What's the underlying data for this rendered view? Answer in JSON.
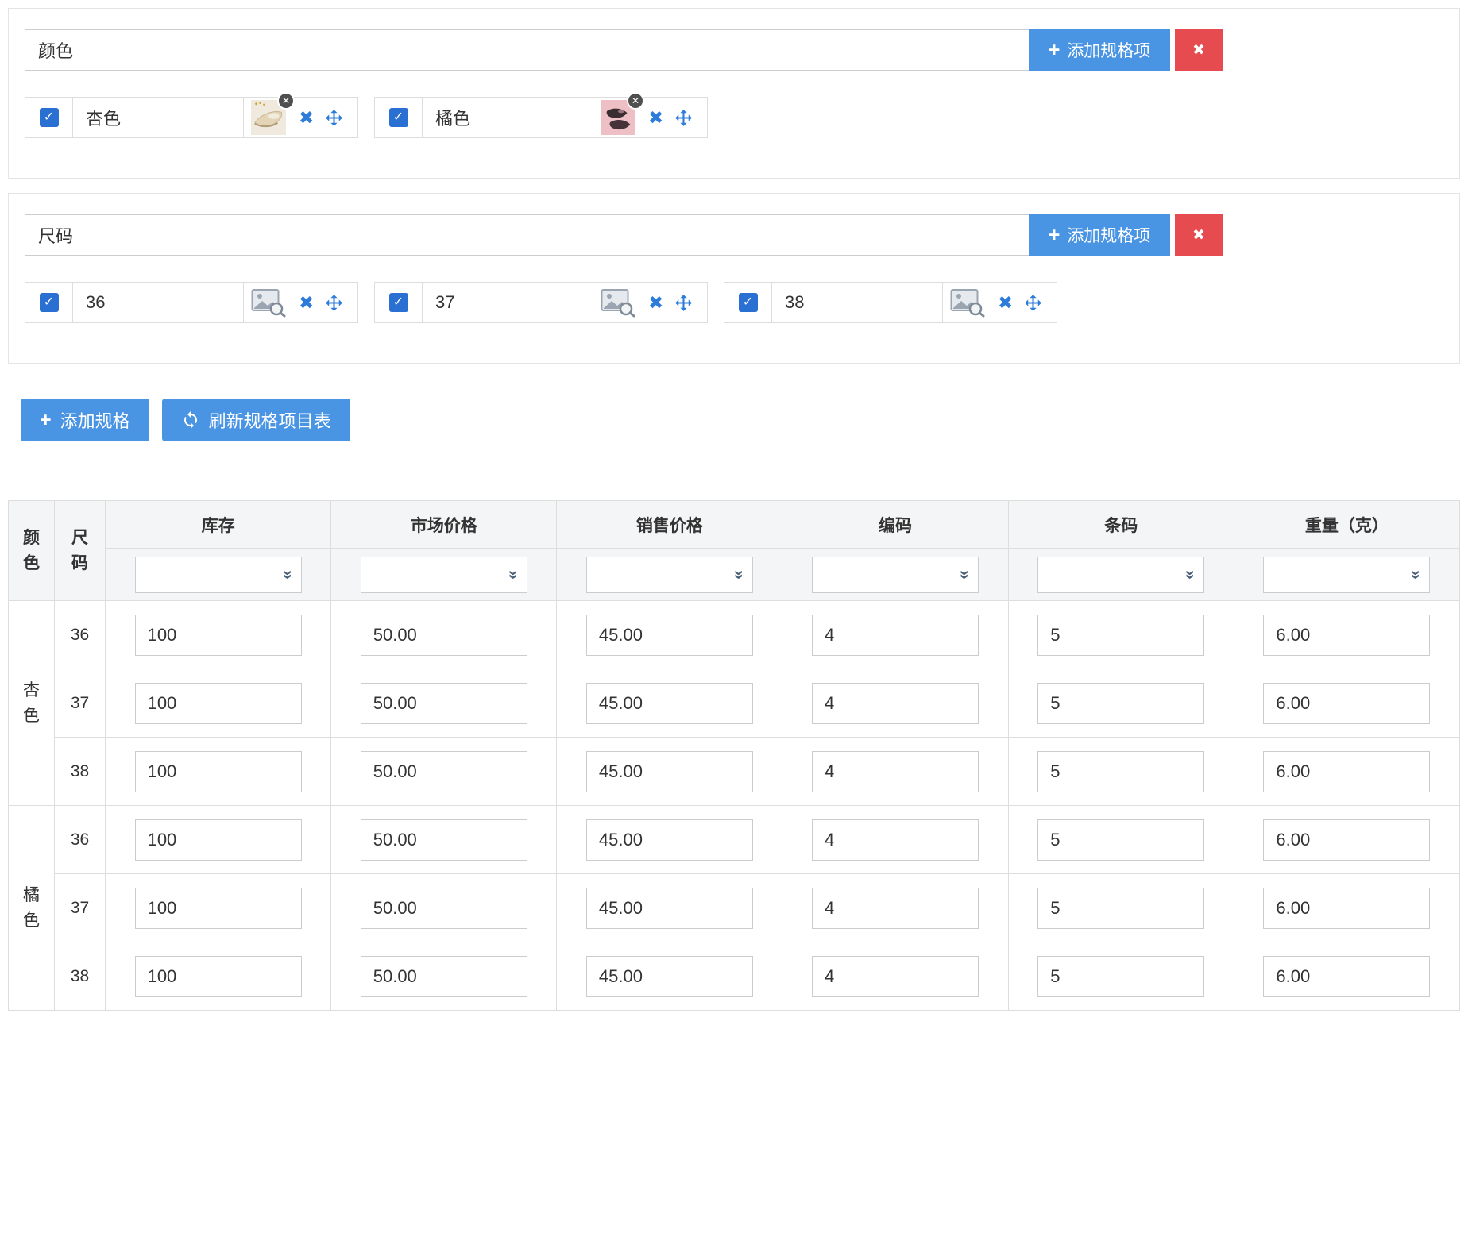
{
  "icons": {
    "plus": "+",
    "check": "✓",
    "close": "✖",
    "badge_close": "✕",
    "chevron_double_down": "»"
  },
  "colors": {
    "primary_blue": "#4a94e4",
    "danger_red": "#e64c4f",
    "icon_blue": "#2e7cd9",
    "checkbox_blue": "#2a6fd2",
    "header_gray": "#f4f5f6",
    "border_gray": "#dddddd"
  },
  "spec_groups": [
    {
      "name": "颜色",
      "add_item_label": "添加规格项",
      "items": [
        {
          "label": "杏色",
          "checked": true,
          "image": "apricot-flat-shoe-photo"
        },
        {
          "label": "橘色",
          "checked": true,
          "image": "dark-shoes-on-pink-photo"
        }
      ]
    },
    {
      "name": "尺码",
      "add_item_label": "添加规格项",
      "items": [
        {
          "label": "36",
          "checked": true,
          "image": "placeholder"
        },
        {
          "label": "37",
          "checked": true,
          "image": "placeholder"
        },
        {
          "label": "38",
          "checked": true,
          "image": "placeholder"
        }
      ]
    }
  ],
  "actions": {
    "add_spec": "添加规格",
    "refresh_table": "刷新规格项目表"
  },
  "sku_table": {
    "row_header_labels": {
      "color": "颜色",
      "size": "尺码"
    },
    "columns": [
      "库存",
      "市场价格",
      "销售价格",
      "编码",
      "条码",
      "重量（克）"
    ],
    "groups": [
      {
        "color": "杏色"
      },
      {
        "color": "橘色"
      }
    ],
    "rows": [
      {
        "group": "杏色",
        "size": "36",
        "stock": "100",
        "market_price": "50.00",
        "sale_price": "45.00",
        "code": "4",
        "barcode": "5",
        "weight": "6.00"
      },
      {
        "group": "杏色",
        "size": "37",
        "stock": "100",
        "market_price": "50.00",
        "sale_price": "45.00",
        "code": "4",
        "barcode": "5",
        "weight": "6.00"
      },
      {
        "group": "杏色",
        "size": "38",
        "stock": "100",
        "market_price": "50.00",
        "sale_price": "45.00",
        "code": "4",
        "barcode": "5",
        "weight": "6.00"
      },
      {
        "group": "橘色",
        "size": "36",
        "stock": "100",
        "market_price": "50.00",
        "sale_price": "45.00",
        "code": "4",
        "barcode": "5",
        "weight": "6.00"
      },
      {
        "group": "橘色",
        "size": "37",
        "stock": "100",
        "market_price": "50.00",
        "sale_price": "45.00",
        "code": "4",
        "barcode": "5",
        "weight": "6.00"
      },
      {
        "group": "橘色",
        "size": "38",
        "stock": "100",
        "market_price": "50.00",
        "sale_price": "45.00",
        "code": "4",
        "barcode": "5",
        "weight": "6.00"
      }
    ],
    "batch_inputs": [
      "",
      "",
      "",
      "",
      "",
      ""
    ]
  }
}
